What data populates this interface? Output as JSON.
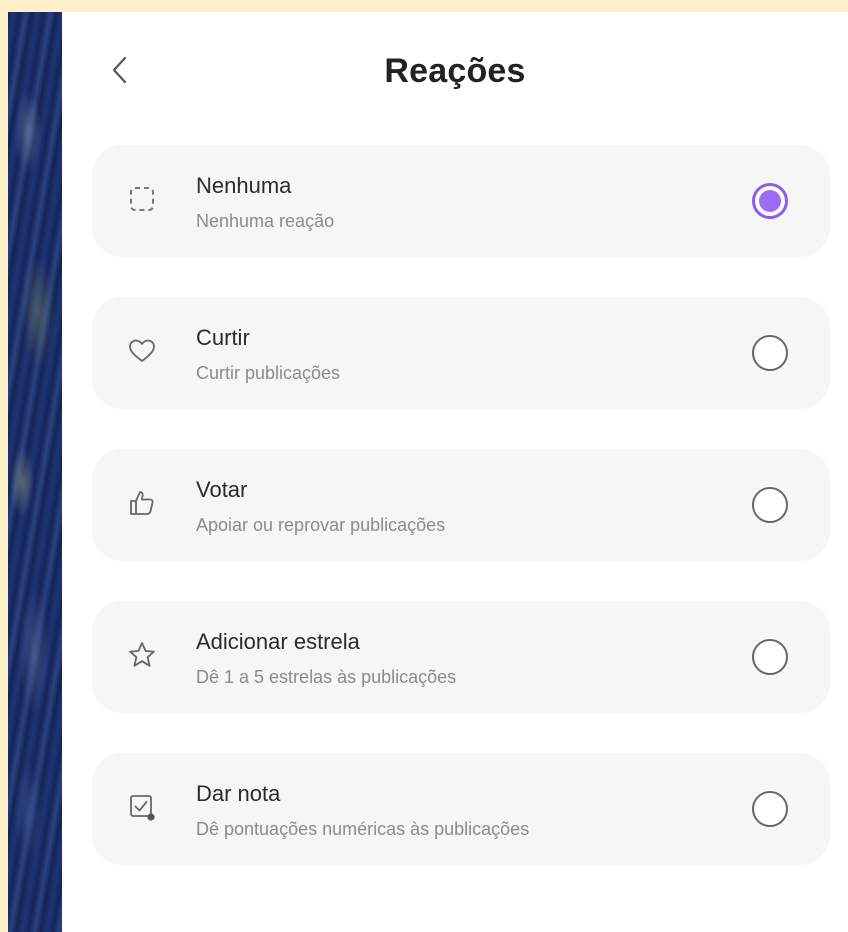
{
  "header": {
    "title": "Reações"
  },
  "options": [
    {
      "label": "Nenhuma",
      "description": "Nenhuma reação",
      "icon": "dashed-square-icon",
      "selected": true
    },
    {
      "label": "Curtir",
      "description": "Curtir publicações",
      "icon": "heart-icon",
      "selected": false
    },
    {
      "label": "Votar",
      "description": "Apoiar ou reprovar publicações",
      "icon": "thumbs-up-icon",
      "selected": false
    },
    {
      "label": "Adicionar estrela",
      "description": "Dê 1 a 5 estrelas às publicações",
      "icon": "star-icon",
      "selected": false
    },
    {
      "label": "Dar nota",
      "description": "Dê pontuações numéricas às publicações",
      "icon": "rating-check-icon",
      "selected": false
    }
  ],
  "colors": {
    "accent": "#9d6cf3",
    "card_background": "#f6f6f7",
    "page_background": "#fdf0c9"
  }
}
